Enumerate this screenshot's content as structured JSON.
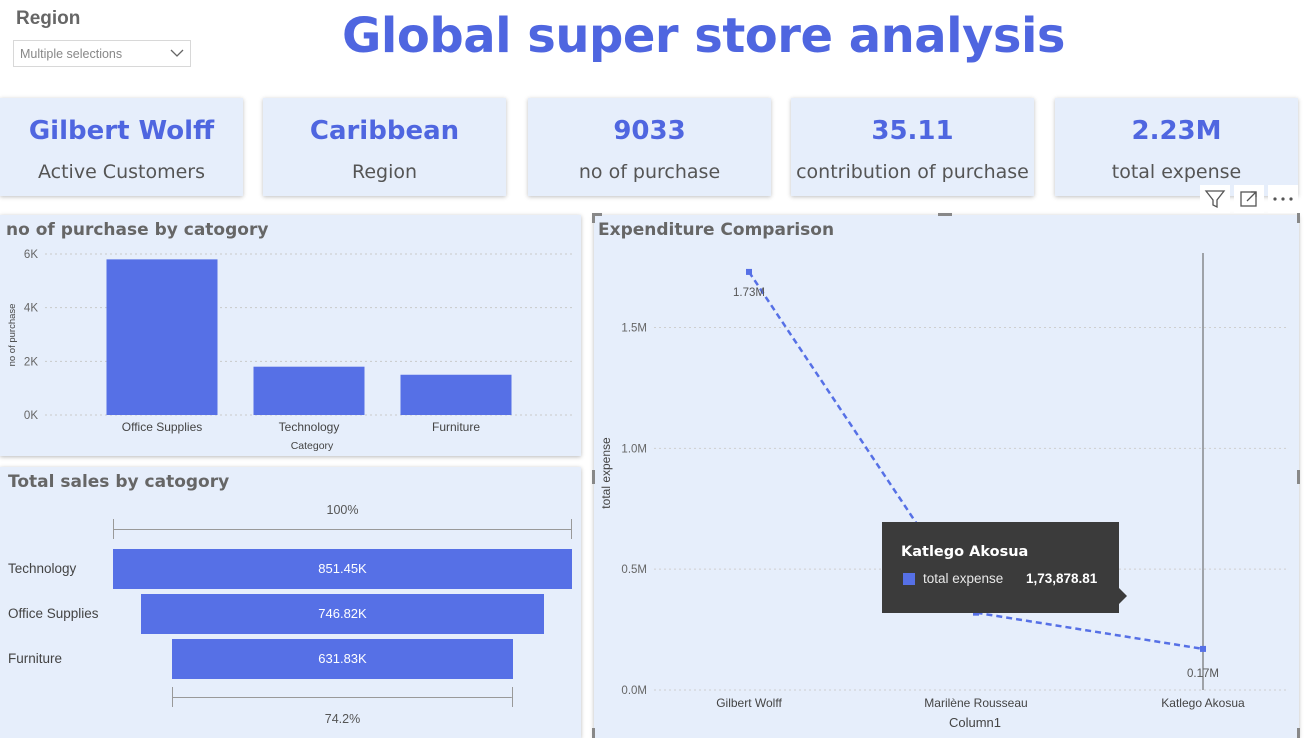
{
  "slicer": {
    "title": "Region",
    "value": "Multiple selections"
  },
  "page_title": "Global super store analysis",
  "cards": [
    {
      "value": "Gilbert Wolff",
      "label": "Active Customers"
    },
    {
      "value": "Caribbean",
      "label": "Region"
    },
    {
      "value": "9033",
      "label": "no of purchase"
    },
    {
      "value": "35.11",
      "label": "contribution of purchase"
    },
    {
      "value": "2.23M",
      "label": "total expense"
    }
  ],
  "visual_header": {
    "icons": [
      "filter-icon",
      "focus-mode-icon",
      "more-options-icon"
    ]
  },
  "colors": {
    "accent": "#4f66e0",
    "bar": "#5670e6",
    "panel_bg": "#e6eefb",
    "tooltip_bg": "#3b3b3b"
  },
  "chart_data": [
    {
      "type": "bar",
      "title": "no of purchase by catogory",
      "xlabel": "Category",
      "ylabel": "no of purchase",
      "categories": [
        "Office Supplies",
        "Technology",
        "Furniture"
      ],
      "values": [
        5800,
        1800,
        1500
      ],
      "ylim": [
        0,
        6000
      ],
      "yticks": [
        "0K",
        "2K",
        "4K",
        "6K"
      ],
      "ytick_values": [
        0,
        2000,
        4000,
        6000
      ],
      "grid": true
    },
    {
      "type": "funnel",
      "title": "Total sales by catogory",
      "categories": [
        "Technology",
        "Office Supplies",
        "Furniture"
      ],
      "values": [
        851.45,
        746.82,
        631.83
      ],
      "value_labels": [
        "851.45K",
        "746.82K",
        "631.83K"
      ],
      "top_pct": "100%",
      "bottom_pct": "74.2%"
    },
    {
      "type": "line",
      "title": "Expenditure Comparison",
      "xlabel": "Column1",
      "ylabel": "total expense",
      "categories": [
        "Gilbert Wolff",
        "Marilène Rousseau",
        "Katlego Akosua"
      ],
      "values": [
        1.73,
        0.32,
        0.17
      ],
      "data_labels": [
        "1.73M",
        "",
        "0.17M"
      ],
      "ylim": [
        0,
        1.8
      ],
      "yticks": [
        "0.0M",
        "0.5M",
        "1.0M",
        "1.5M"
      ],
      "ytick_values": [
        0,
        0.5,
        1.0,
        1.5
      ],
      "grid": true,
      "tooltip": {
        "title": "Katlego Akosua",
        "label": "total expense",
        "value": "1,73,878.81"
      }
    }
  ]
}
